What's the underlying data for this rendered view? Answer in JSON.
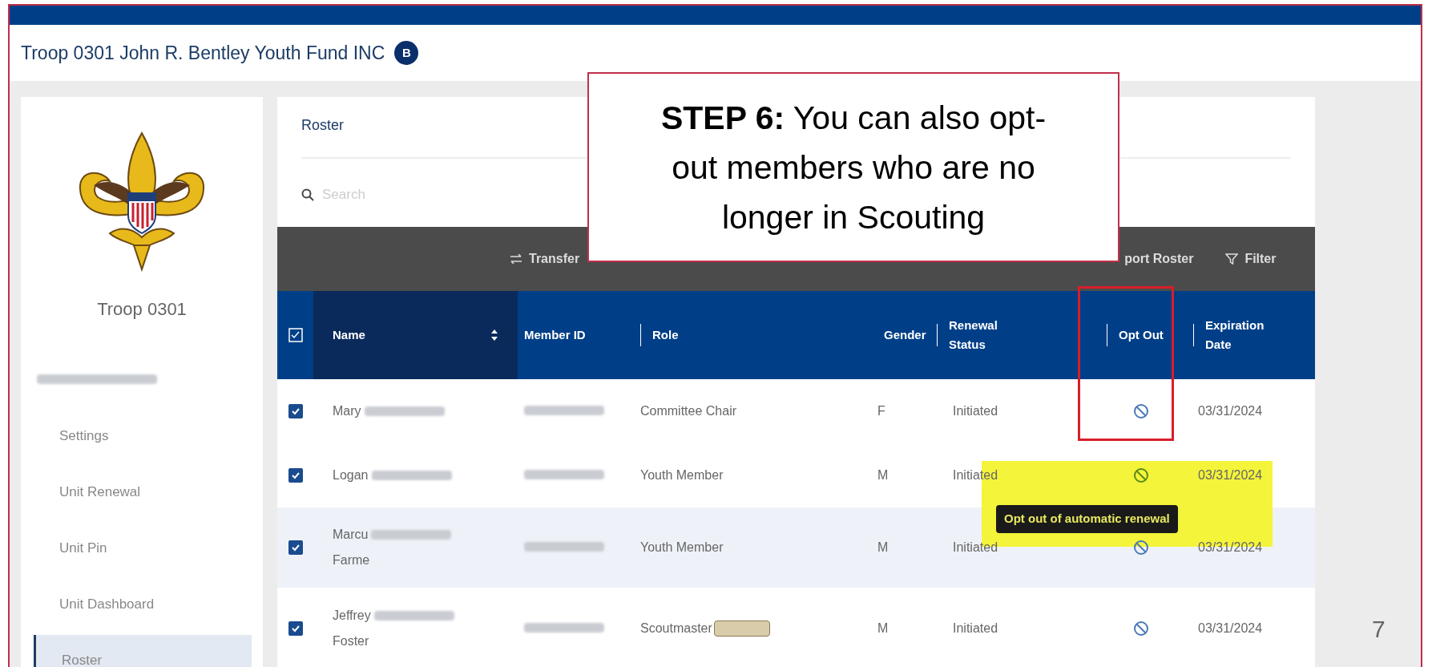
{
  "header": {
    "org_name": "Troop 0301 John R. Bentley Youth Fund INC",
    "badge": "B"
  },
  "sidebar": {
    "unit": "Troop 0301",
    "items": [
      {
        "label": "Settings",
        "selected": false
      },
      {
        "label": "Unit Renewal",
        "selected": false
      },
      {
        "label": "Unit Pin",
        "selected": false
      },
      {
        "label": "Unit Dashboard",
        "selected": false
      },
      {
        "label": "Roster",
        "selected": true
      }
    ]
  },
  "roster": {
    "title": "Roster",
    "search_placeholder": "Search",
    "toolbar": [
      {
        "label": "Transfer",
        "kind": "transfer"
      },
      {
        "label": "port Roster",
        "kind": "plain"
      },
      {
        "label": "Filter",
        "kind": "filter"
      }
    ],
    "columns": [
      "Name",
      "Member ID",
      "Role",
      "Gender",
      "Renewal Status",
      "Opt Out",
      "Expiration Date"
    ],
    "rows": [
      {
        "name": "Mary",
        "name_line2": "",
        "role": "Committee Chair",
        "trained": false,
        "gender": "F",
        "renewal_status": "Initiated",
        "expiration": "03/31/2024",
        "checked": true,
        "opt_out_hovered": false
      },
      {
        "name": "Logan",
        "name_line2": "",
        "role": "Youth Member",
        "trained": false,
        "gender": "M",
        "renewal_status": "Initiated",
        "expiration": "03/31/2024",
        "checked": true,
        "opt_out_hovered": true
      },
      {
        "name": "Marcu",
        "name_line2": "Farme",
        "role": "Youth Member",
        "trained": false,
        "gender": "M",
        "renewal_status": "Initiated",
        "expiration": "03/31/2024",
        "checked": true,
        "opt_out_hovered": false
      },
      {
        "name": "Jeffrey",
        "name_line2": "Foster",
        "role": "Scoutmaster",
        "trained": true,
        "gender": "M",
        "renewal_status": "Initiated",
        "expiration": "03/31/2024",
        "checked": true,
        "opt_out_hovered": false
      }
    ],
    "tooltip": "Opt out of automatic renewal"
  },
  "callout": "**STEP 6:** You can also opt-out members who are no longer in Scouting",
  "slide_number": "7"
}
